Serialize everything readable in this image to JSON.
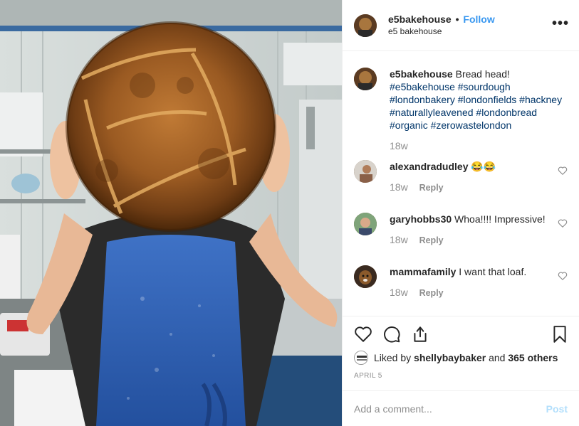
{
  "post": {
    "username": "e5bakehouse",
    "separator": "•",
    "follow_label": "Follow",
    "full_name": "e5 bakehouse",
    "more_label": "•••"
  },
  "caption": {
    "username": "e5bakehouse",
    "text": "Bread head!",
    "hashtags": [
      "#e5bakehouse",
      "#sourdough",
      "#londonbakery",
      "#londonfields",
      "#hackney",
      "#naturallyleavened",
      "#londonbread",
      "#organic",
      "#zerowastelondon"
    ],
    "time": "18w"
  },
  "comments": [
    {
      "username": "alexandradudley",
      "text": "😂😂",
      "time": "18w",
      "reply_label": "Reply"
    },
    {
      "username": "garyhobbs30",
      "text": "Whoa!!!! Impressive!",
      "time": "18w",
      "reply_label": "Reply"
    },
    {
      "username": "mammafamily",
      "text": "I want that loaf.",
      "time": "18w",
      "reply_label": "Reply"
    }
  ],
  "likes": {
    "prefix": "Liked by",
    "user": "shellybaybaker",
    "conjunction": "and",
    "others": "365 others"
  },
  "date": "APRIL 5",
  "comment_box": {
    "placeholder": "Add a comment...",
    "post_label": "Post"
  },
  "colors": {
    "link_blue": "#3897f0",
    "hashtag_blue": "#003569",
    "post_disabled": "#b2dffc",
    "apron_blue": "#2f5fb3",
    "bread_crust": "#9a5a22"
  },
  "icons": [
    "heart-icon",
    "comment-icon",
    "share-icon",
    "bookmark-icon",
    "more-options-icon",
    "small-heart-icon"
  ]
}
